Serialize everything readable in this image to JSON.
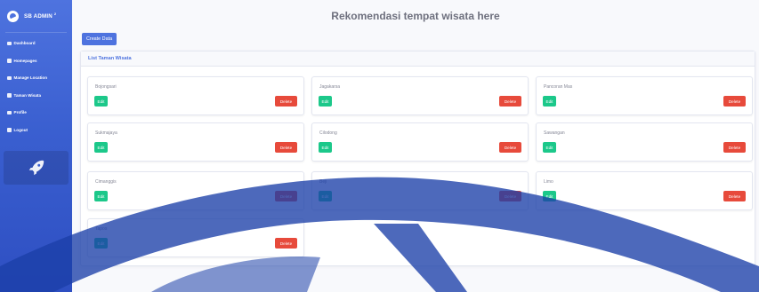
{
  "brand": {
    "name": "SB ADMIN",
    "sup": "2"
  },
  "sidebar": {
    "items": [
      {
        "label": "Dashboard"
      },
      {
        "label": "Homepages"
      },
      {
        "label": "Manage Location"
      },
      {
        "label": "Taman Wisata"
      },
      {
        "label": "Profile"
      },
      {
        "label": "Logout"
      }
    ]
  },
  "header": {
    "title": "Rekomendasi tempat wisata here"
  },
  "toolbar": {
    "create_label": "Create Data"
  },
  "card": {
    "title": "List Taman Wisata"
  },
  "buttons": {
    "edit": "Edit",
    "delete": "Delete"
  },
  "places": [
    {
      "name": "Bojongsari"
    },
    {
      "name": "Jagakarsa"
    },
    {
      "name": "Pancoran Mas"
    },
    {
      "name": "Sukmajaya"
    },
    {
      "name": "Cilodong"
    },
    {
      "name": "Sawangan"
    },
    {
      "name": "Cimanggis"
    },
    {
      "name": "Beji"
    },
    {
      "name": "Limo"
    },
    {
      "name": "Tapos"
    }
  ],
  "colors": {
    "primary": "#4e73df",
    "success": "#1cc88a",
    "danger": "#e74a3b",
    "watermark": "#1b3fa8"
  },
  "icons": {
    "brand": "laugh-wink-icon",
    "nav": "tachometer-icon",
    "sidebar_card": "rocket-icon"
  }
}
